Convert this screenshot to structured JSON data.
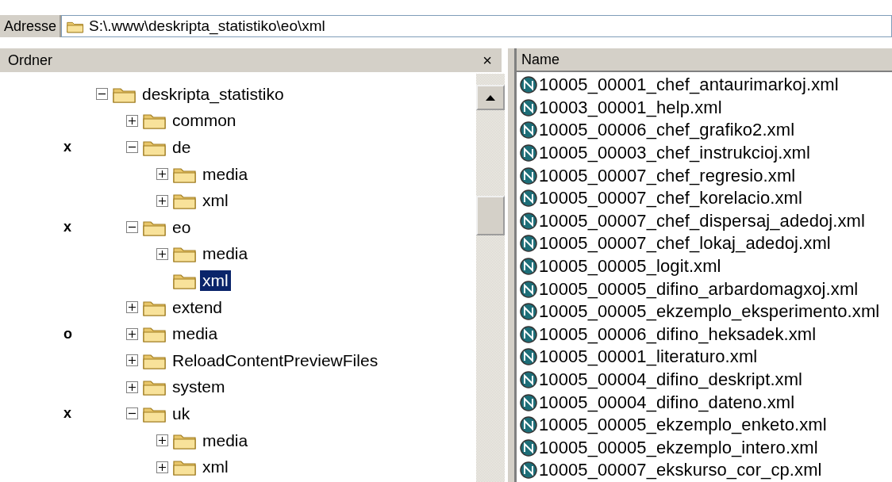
{
  "address_bar": {
    "label": "Adresse",
    "path": "S:\\.www\\deskripta_statistiko\\eo\\xml"
  },
  "folder_pane": {
    "title": "Ordner",
    "close": "×",
    "tree": [
      {
        "label": "deskripta_statistiko",
        "kind": "expandable",
        "expanded": true,
        "selected": false,
        "children": [
          {
            "label": "common",
            "kind": "expandable",
            "expanded": false,
            "selected": false
          },
          {
            "label": "de",
            "marker": "x",
            "kind": "expandable",
            "expanded": true,
            "selected": false,
            "children": [
              {
                "label": "media",
                "kind": "expandable",
                "expanded": false,
                "selected": false
              },
              {
                "label": "xml",
                "kind": "expandable",
                "expanded": false,
                "selected": false
              }
            ]
          },
          {
            "label": "eo",
            "marker": "x",
            "kind": "expandable",
            "expanded": true,
            "selected": false,
            "children": [
              {
                "label": "media",
                "kind": "expandable",
                "expanded": false,
                "selected": false
              },
              {
                "label": "xml",
                "kind": "leaf",
                "selected": true
              }
            ]
          },
          {
            "label": "extend",
            "kind": "expandable",
            "expanded": false,
            "selected": false
          },
          {
            "label": "media",
            "marker": "o",
            "kind": "expandable",
            "expanded": false,
            "selected": false
          },
          {
            "label": "ReloadContentPreviewFiles",
            "kind": "expandable",
            "expanded": false,
            "selected": false
          },
          {
            "label": "system",
            "kind": "expandable",
            "expanded": false,
            "selected": false
          },
          {
            "label": "uk",
            "marker": "x",
            "kind": "expandable",
            "expanded": true,
            "selected": false,
            "children": [
              {
                "label": "media",
                "kind": "expandable",
                "expanded": false,
                "selected": false
              },
              {
                "label": "xml",
                "kind": "expandable",
                "expanded": false,
                "selected": false
              }
            ]
          }
        ]
      }
    ]
  },
  "file_list": {
    "columns": [
      "Name"
    ],
    "files": [
      "10005_00001_chef_antaurimarkoj.xml",
      "10003_00001_help.xml",
      "10005_00006_chef_grafiko2.xml",
      "10005_00003_chef_instrukcioj.xml",
      "10005_00007_chef_regresio.xml",
      "10005_00007_chef_korelacio.xml",
      "10005_00007_chef_dispersaj_adedoj.xml",
      "10005_00007_chef_lokaj_adedoj.xml",
      "10005_00005_logit.xml",
      "10005_00005_difino_arbardomagxoj.xml",
      "10005_00005_ekzemplo_eksperimento.xml",
      "10005_00006_difino_heksadek.xml",
      "10005_00001_literaturo.xml",
      "10005_00004_difino_deskript.xml",
      "10005_00004_difino_dateno.xml",
      "10005_00005_ekzemplo_enketo.xml",
      "10005_00005_ekzemplo_intero.xml",
      "10005_00007_ekskurso_cor_cp.xml"
    ]
  }
}
